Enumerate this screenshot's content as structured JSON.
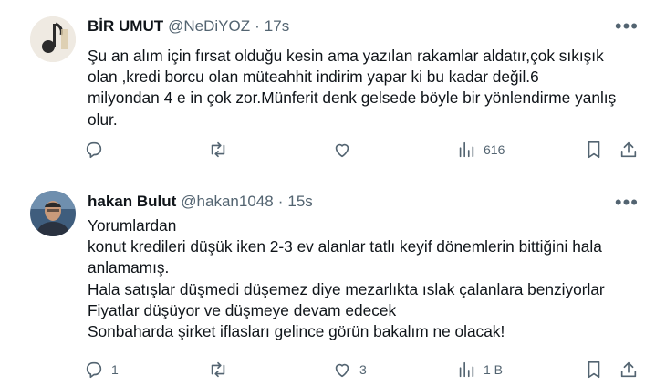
{
  "tweets": [
    {
      "name": "BİR UMUT",
      "handle": "@NeDiYOZ",
      "separator": "·",
      "time": "17s",
      "more": "•••",
      "lines": [
        "Şu an alım için fırsat olduğu kesin ama yazılan rakamlar aldatır,çok sıkışık",
        "olan ,kredi borcu olan müteahhit indirim yapar ki bu kadar değil.6",
        "milyondan 4 e in çok zor.Münferit denk gelsede böyle bir yönlendirme yanlış",
        "olur."
      ],
      "actions": {
        "replies": "",
        "retweets": "",
        "likes": "",
        "views": "616"
      }
    },
    {
      "name": "hakan Bulut",
      "handle": "@hakan1048",
      "separator": "·",
      "time": "15s",
      "more": "•••",
      "lines": [
        "Yorumlardan",
        "konut kredileri düşük iken 2-3 ev alanlar tatlı keyif dönemlerin bittiğini hala",
        "anlamamış.",
        "Hala satışlar düşmedi düşemez diye mezarlıkta ıslak çalanlara benziyorlar",
        "Fiyatlar düşüyor ve düşmeye devam edecek",
        "Sonbaharda şirket iflasları gelince görün bakalım ne olacak!"
      ],
      "actions": {
        "replies": "1",
        "retweets": "",
        "likes": "3",
        "views": "1 B"
      }
    }
  ],
  "icons": {
    "reply": "reply-icon",
    "retweet": "retweet-icon",
    "like": "heart-icon",
    "views": "views-icon",
    "bookmark": "bookmark-icon",
    "share": "share-icon"
  },
  "colors": {
    "text": "#0f1419",
    "secondary": "#536471",
    "divider": "#eff3f4"
  }
}
